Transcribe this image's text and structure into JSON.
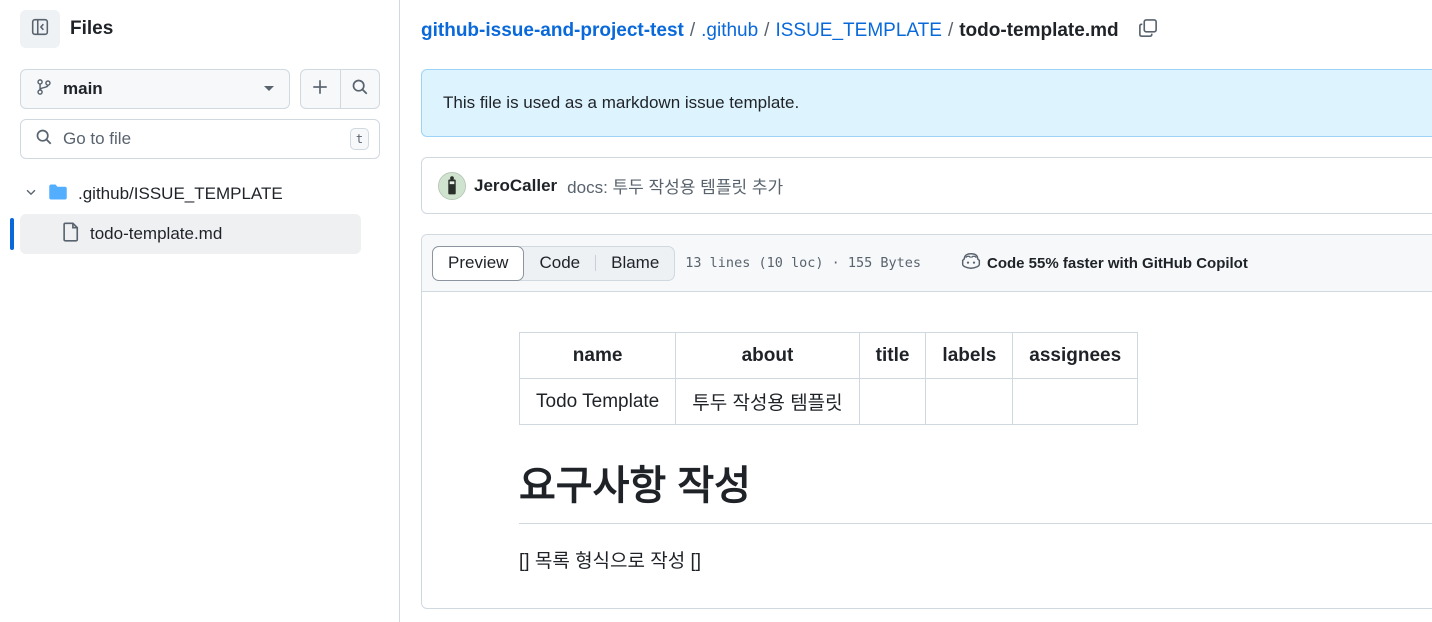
{
  "sidebar": {
    "title": "Files",
    "branch": "main",
    "goto_placeholder": "Go to file",
    "goto_shortcut": "t",
    "tree": {
      "folder": ".github/ISSUE_TEMPLATE",
      "file": "todo-template.md"
    }
  },
  "breadcrumb": {
    "repo": "github-issue-and-project-test",
    "sep": "/",
    "dir1": ".github",
    "dir2": "ISSUE_TEMPLATE",
    "current": "todo-template.md"
  },
  "notice": "This file is used as a markdown issue template.",
  "commit": {
    "author": "JeroCaller",
    "message": "docs: 투두 작성용 템플릿 추가"
  },
  "file_header": {
    "tabs": [
      "Preview",
      "Code",
      "Blame"
    ],
    "active_tab": "Preview",
    "meta": "13 lines (10 loc) · 155 Bytes",
    "copilot": "Code 55% faster with GitHub Copilot"
  },
  "markdown": {
    "table": {
      "headers": [
        "name",
        "about",
        "title",
        "labels",
        "assignees"
      ],
      "rows": [
        [
          "Todo Template",
          "투두 작성용 템플릿",
          "",
          "",
          ""
        ]
      ]
    },
    "heading": "요구사항 작성",
    "paragraph": "[] 목록 형식으로 작성 []"
  },
  "colors": {
    "link": "#0969da",
    "notice_bg": "#ddf4ff",
    "folder": "#54aeff"
  }
}
